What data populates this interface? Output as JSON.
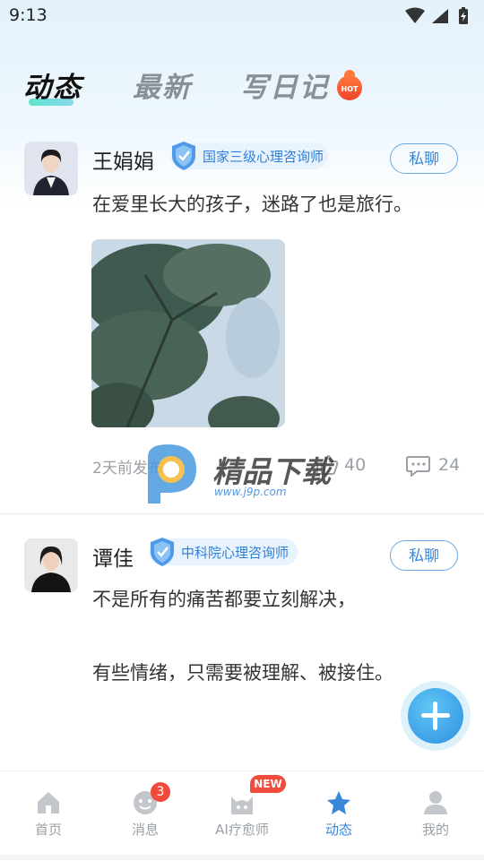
{
  "status_bar": {
    "time": "9:13"
  },
  "tabs": [
    {
      "label": "动态",
      "active": true
    },
    {
      "label": "最新",
      "active": false
    },
    {
      "label": "写日记",
      "active": false,
      "badge": "HOT"
    }
  ],
  "posts": [
    {
      "name": "王娟娟",
      "cert": "国家三级心理咨询师",
      "chat_label": "私聊",
      "content": [
        "在爱里长大的孩子，迷路了也是旅行。"
      ],
      "time": "2天前发布",
      "likes": "40",
      "comments": "24"
    },
    {
      "name": "谭佳",
      "cert": "中科院心理咨询师",
      "chat_label": "私聊",
      "content": [
        "不是所有的痛苦都要立刻解决，",
        "有些情绪，只需要被理解、被接住。"
      ]
    }
  ],
  "watermark": {
    "title": "精品下载",
    "url": "www.j9p.com"
  },
  "bottom_nav": [
    {
      "label": "首页",
      "icon": "home-icon",
      "active": false
    },
    {
      "label": "消息",
      "icon": "message-icon",
      "active": false,
      "badge": "3"
    },
    {
      "label": "AI疗愈师",
      "icon": "ai-healer-icon",
      "active": false,
      "badge": "NEW"
    },
    {
      "label": "动态",
      "icon": "star-icon",
      "active": true
    },
    {
      "label": "我的",
      "icon": "profile-icon",
      "active": false
    }
  ],
  "colors": {
    "accent": "#3a86d8",
    "badge": "#f04a3a",
    "inactive": "#9aa0a6"
  }
}
